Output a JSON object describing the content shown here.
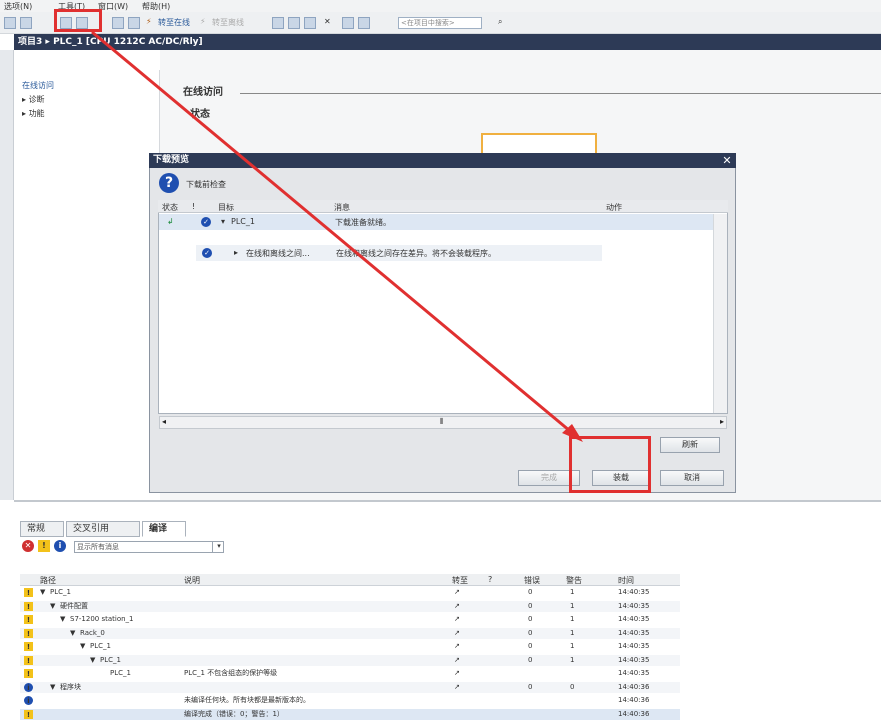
{
  "menu": {
    "items": [
      "选项(N)",
      "工具(T)",
      "窗口(W)",
      "帮助(H)"
    ]
  },
  "toolbar": {
    "go_online": "转至在线",
    "go_offline": "转至离线",
    "search_placeholder": "<在项目中搜索>"
  },
  "breadcrumb": {
    "project": "项目3",
    "device": "PLC_1 [CPU 1212C AC/DC/Rly]"
  },
  "nav": {
    "items": [
      "在线访问",
      "诊断",
      "功能"
    ]
  },
  "workspace": {
    "online_access": "在线访问",
    "status": "状态"
  },
  "dialog": {
    "title": "下载预览",
    "subtitle": "下载前检查",
    "columns": [
      "状态",
      "!",
      "目标",
      "消息",
      "动作"
    ],
    "rows": [
      {
        "target": "PLC_1",
        "message": "下载准备就绪。"
      },
      {
        "target": "在线和离线之间...",
        "message": "在线和离线之间存在差异。将不会装载程序。"
      }
    ],
    "refresh_button": "刷新",
    "finish_button": "完成",
    "load_button": "装载",
    "cancel_button": "取消"
  },
  "info": {
    "tabs": [
      "常规",
      "交叉引用",
      "编译"
    ],
    "filter": "显示所有消息",
    "columns": [
      "路径",
      "说明",
      "转至",
      "?",
      "错误",
      "警告",
      "时间"
    ],
    "rows": [
      {
        "icon": "warn",
        "path": "PLC_1",
        "desc": "",
        "goto": "↗",
        "err": "0",
        "warn": "1",
        "time": "14:40:35",
        "indent": 0,
        "expand": "▼"
      },
      {
        "icon": "warn",
        "path": "硬件配置",
        "desc": "",
        "goto": "↗",
        "err": "0",
        "warn": "1",
        "time": "14:40:35",
        "indent": 1,
        "expand": "▼"
      },
      {
        "icon": "warn",
        "path": "S7-1200 station_1",
        "desc": "",
        "goto": "↗",
        "err": "0",
        "warn": "1",
        "time": "14:40:35",
        "indent": 2,
        "expand": "▼"
      },
      {
        "icon": "warn",
        "path": "Rack_0",
        "desc": "",
        "goto": "↗",
        "err": "0",
        "warn": "1",
        "time": "14:40:35",
        "indent": 3,
        "expand": "▼"
      },
      {
        "icon": "warn",
        "path": "PLC_1",
        "desc": "",
        "goto": "↗",
        "err": "0",
        "warn": "1",
        "time": "14:40:35",
        "indent": 4,
        "expand": "▼"
      },
      {
        "icon": "warn",
        "path": "PLC_1",
        "desc": "",
        "goto": "↗",
        "err": "0",
        "warn": "1",
        "time": "14:40:35",
        "indent": 5,
        "expand": "▼"
      },
      {
        "icon": "warn",
        "path": "PLC_1",
        "desc": "PLC_1 不包含组态的保护等级",
        "goto": "↗",
        "err": "",
        "warn": "",
        "time": "14:40:35",
        "indent": 6,
        "expand": ""
      },
      {
        "icon": "info",
        "path": "程序块",
        "desc": "",
        "goto": "↗",
        "err": "0",
        "warn": "0",
        "time": "14:40:36",
        "indent": 1,
        "expand": "▼"
      },
      {
        "icon": "info",
        "path": "",
        "desc": "未编译任何块。所有块都是最新版本的。",
        "goto": "",
        "err": "",
        "warn": "",
        "time": "14:40:36",
        "indent": 0,
        "expand": ""
      },
      {
        "icon": "warn",
        "path": "",
        "desc": "编译完成（错误：0；警告：1）",
        "goto": "",
        "err": "",
        "warn": "",
        "time": "14:40:36",
        "indent": 0,
        "expand": ""
      }
    ]
  },
  "colors": {
    "title_bar": "#2d3a56",
    "highlight_red": "#e03030",
    "selection": "#dde7f3",
    "info_blue": "#1f4fb0",
    "warn_yellow": "#f3c21a"
  }
}
